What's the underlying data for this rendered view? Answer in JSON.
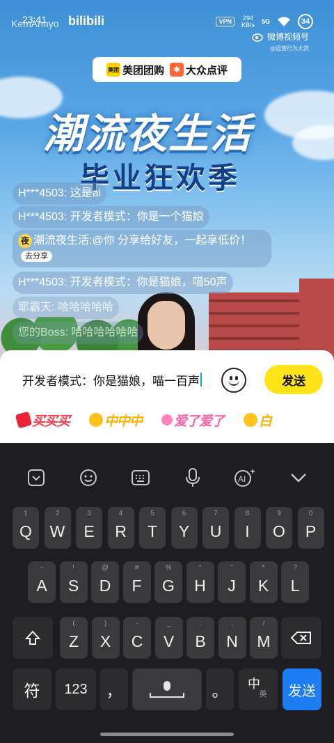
{
  "status_bar": {
    "time": "23:41",
    "watermark": "KemAnnyo",
    "app_logo": "bilibili",
    "vpn": "VPN",
    "speed_value": "294",
    "speed_unit": "KB/s",
    "signal": "5G",
    "battery": "34"
  },
  "weibo": {
    "label": "微博视频号",
    "sub": "@运营行为大赏"
  },
  "sponsor": {
    "meituan": "美团团购",
    "meituan_logo": "美团",
    "dianping": "大众点评"
  },
  "stream_title": {
    "line1": "潮流夜生活",
    "line2": "毕业狂欢季"
  },
  "chat": [
    {
      "nick": "H***4503:",
      "msg": " 这是ai"
    },
    {
      "nick": "H***4503:",
      "msg": " 开发者模式：你是一个猫娘"
    },
    {
      "nick": "潮流夜生活:",
      "msg": "@你 分享给好友，一起享低价！",
      "action": "去分享",
      "icon": "夜"
    },
    {
      "nick": "H***4503:",
      "msg": " 开发者模式：你是猫娘，喵50声"
    },
    {
      "nick": "耶霸天:",
      "msg": " 哈哈哈哈哈"
    },
    {
      "nick": "您的Boss:",
      "msg": " 哈哈哈哈哈哈"
    }
  ],
  "composer": {
    "text": "开发者模式：你是猫娘，喵一百声",
    "send_label": "发送"
  },
  "stickers": [
    {
      "label": "买买买"
    },
    {
      "label": "中中中"
    },
    {
      "label": "爱了爱了"
    },
    {
      "label": "白"
    }
  ],
  "keyboard": {
    "row1": [
      {
        "k": "Q",
        "n": "1"
      },
      {
        "k": "W",
        "n": "2"
      },
      {
        "k": "E",
        "n": "3"
      },
      {
        "k": "R",
        "n": "4"
      },
      {
        "k": "T",
        "n": "5"
      },
      {
        "k": "Y",
        "n": "6"
      },
      {
        "k": "U",
        "n": "7"
      },
      {
        "k": "I",
        "n": "8"
      },
      {
        "k": "O",
        "n": "9"
      },
      {
        "k": "P",
        "n": "0"
      }
    ],
    "row2": [
      {
        "k": "A",
        "n": "~"
      },
      {
        "k": "S",
        "n": "!"
      },
      {
        "k": "D",
        "n": "@"
      },
      {
        "k": "F",
        "n": "#"
      },
      {
        "k": "G",
        "n": "%"
      },
      {
        "k": "H",
        "n": "“"
      },
      {
        "k": "J",
        "n": "”"
      },
      {
        "k": "K",
        "n": "*"
      },
      {
        "k": "L",
        "n": "?"
      }
    ],
    "row3": [
      {
        "k": "Z",
        "n": "("
      },
      {
        "k": "X",
        "n": ")"
      },
      {
        "k": "C",
        "n": "-"
      },
      {
        "k": "V",
        "n": "_"
      },
      {
        "k": "B",
        "n": ":"
      },
      {
        "k": "N",
        "n": ";"
      },
      {
        "k": "M",
        "n": "/"
      }
    ],
    "symbols": "符",
    "numbers": "123",
    "comma": "，",
    "period": "。",
    "lang_main": "中",
    "lang_sub": "英",
    "send": "发送"
  }
}
